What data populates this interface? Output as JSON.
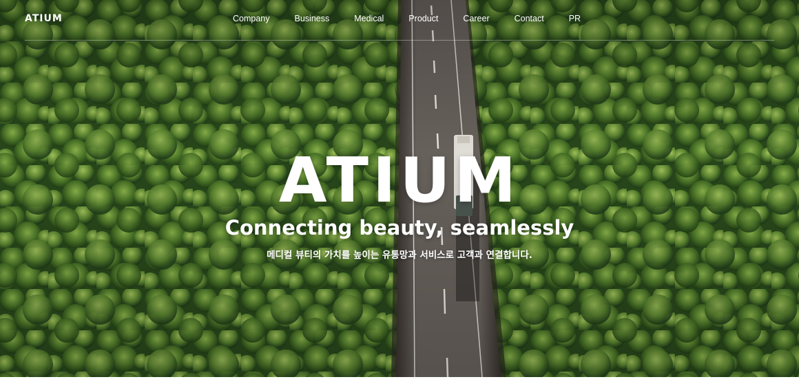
{
  "header": {
    "logo": "ATIUM",
    "nav": [
      {
        "label": "Company"
      },
      {
        "label": "Business"
      },
      {
        "label": "Medical"
      },
      {
        "label": "Product"
      },
      {
        "label": "Career"
      },
      {
        "label": "Contact"
      },
      {
        "label": "PR"
      }
    ]
  },
  "hero": {
    "brand": "ATIUM",
    "tagline": "Connecting beauty, seamlessly",
    "subtitle": "메디컬 뷰티의 가치를 높이는 유통망과 서비스로 고객과 연결합니다.",
    "background": "aerial-forest-road-with-truck",
    "colors": {
      "forest_dark": "#1e3a17",
      "forest_light": "#6f9a3a",
      "road": "#6e6a66",
      "text": "#ffffff"
    }
  }
}
